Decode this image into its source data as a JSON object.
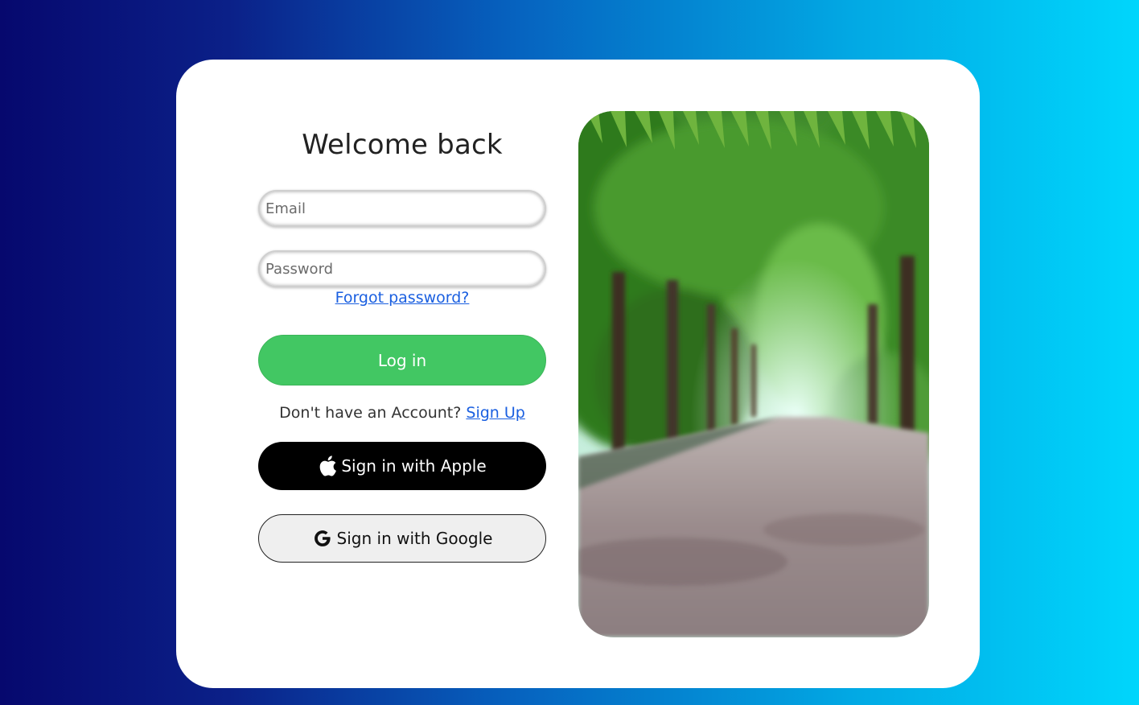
{
  "login": {
    "title": "Welcome back",
    "email_placeholder": "Email",
    "password_placeholder": "Password",
    "forgot_label": "Forgot password?",
    "login_label": "Log in",
    "no_account_text": "Don't have an Account?",
    "signup_label": "Sign Up",
    "apple_label": "Sign in with Apple",
    "google_label": "Sign in with Google"
  },
  "icons": {
    "apple": "apple-icon",
    "google": "google-icon"
  },
  "colors": {
    "login_button": "#42c763",
    "link": "#1a5fe0",
    "apple_button": "#000000",
    "google_button": "#efefef",
    "background_start": "#06086e",
    "background_end": "#00d6fc"
  }
}
